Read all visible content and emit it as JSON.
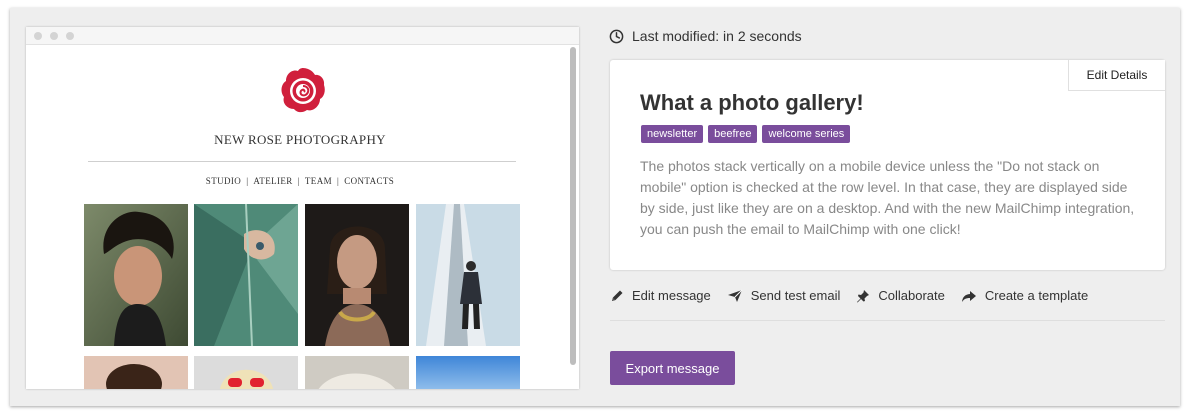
{
  "preview": {
    "brand_name": "NEW ROSE PHOTOGRAPHY",
    "nav": [
      "STUDIO",
      "ATELIER",
      "TEAM",
      "CONTACTS"
    ],
    "nav_separator": "|",
    "brand_color": "#d01f3c"
  },
  "meta": {
    "last_modified": "Last modified: in 2 seconds"
  },
  "card": {
    "edit_details_label": "Edit Details",
    "title": "What a photo gallery!",
    "tags": [
      "newsletter",
      "beefree",
      "welcome series"
    ],
    "description": "The photos stack vertically on a mobile device unless the \"Do not stack on mobile\" option is checked at the row level. In that case, they are displayed side by side, just like they are on a desktop. And with the new MailChimp integration, you can push the email to MailChimp with one click!"
  },
  "actions": {
    "edit": {
      "label": "Edit message",
      "icon": "pencil-icon"
    },
    "send_test": {
      "label": "Send test email",
      "icon": "paper-plane-icon"
    },
    "collaborate": {
      "label": "Collaborate",
      "icon": "pin-icon"
    },
    "create_template": {
      "label": "Create a template",
      "icon": "share-arrow-icon"
    }
  },
  "export_label": "Export message",
  "accent_color": "#7a4d9c"
}
